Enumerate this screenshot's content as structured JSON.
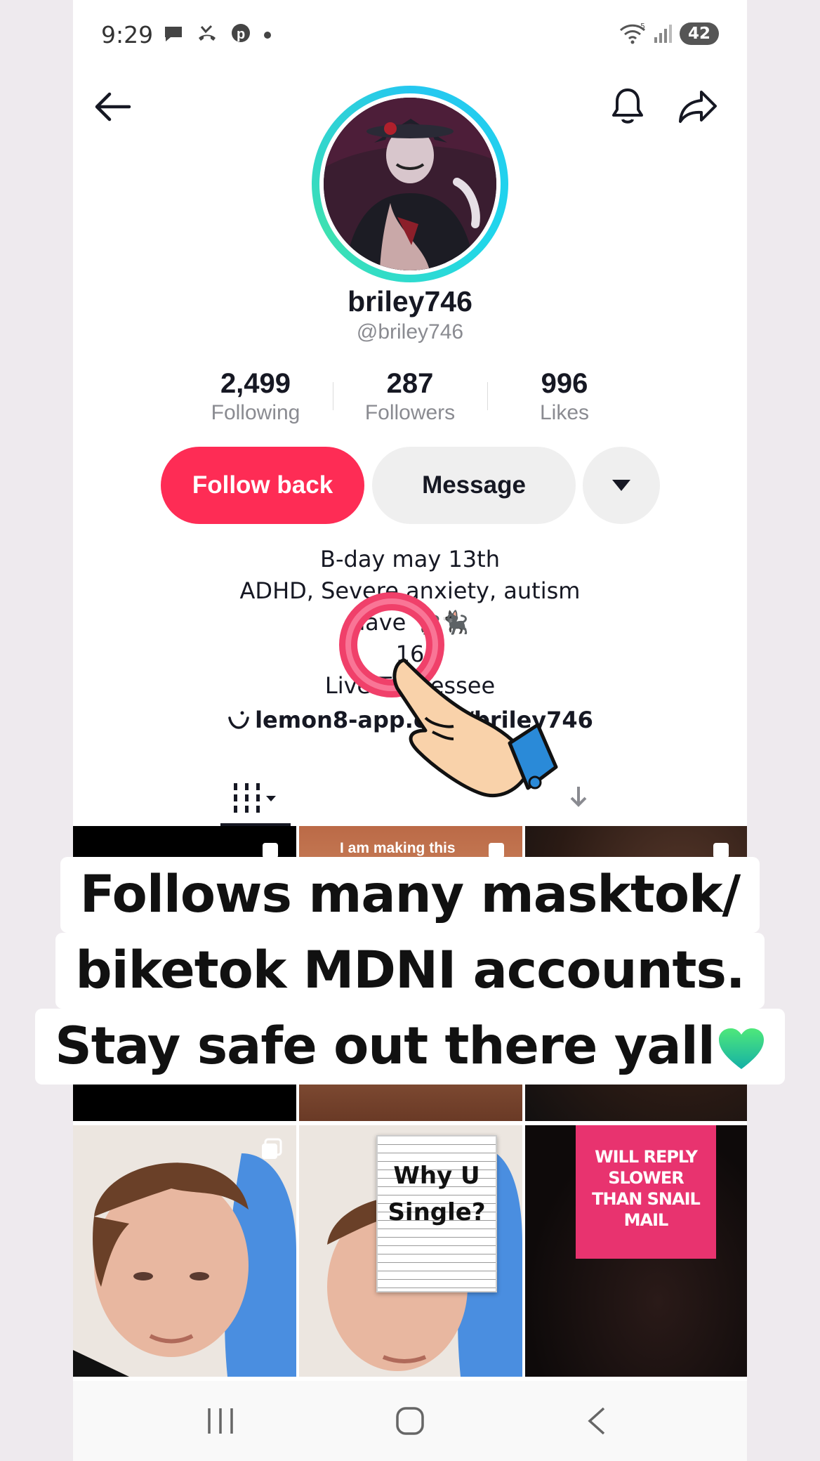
{
  "status_bar": {
    "time": "9:29",
    "left_icons": [
      "chat-bubble-icon",
      "missed-call-icon",
      "pinterest-icon",
      "dot-icon"
    ],
    "signal_label": "5",
    "battery": "42"
  },
  "profile": {
    "display_name": "briley746",
    "handle": "@briley746",
    "stats": [
      {
        "value": "2,499",
        "label": "Following"
      },
      {
        "value": "287",
        "label": "Followers"
      },
      {
        "value": "996",
        "label": "Likes"
      }
    ],
    "follow_button": "Follow back",
    "message_button": "Message",
    "bio_lines": [
      "B-day may 13th",
      "ADHD, Severe anxiety, autism",
      "have 🐈‍⬛🐈‍⬛",
      "16",
      "Live Tennessee"
    ],
    "link": "lemon8-app.com/briley746"
  },
  "grid": {
    "tile_text": "I am making this",
    "why_single": [
      "Why U",
      "Single?"
    ],
    "reply_note": [
      "WILL REPLY",
      "SLOWER",
      "THAN SNAIL",
      "MAIL"
    ]
  },
  "caption": {
    "lines": [
      "Follows many masktok/",
      "biketok MDNI accounts.",
      "Stay safe out there yall"
    ],
    "emoji": "green-heart-icon"
  },
  "colors": {
    "follow_accent": "#fe2c55",
    "avatar_ring": "#25c7f0",
    "pink_note": "#e8336f"
  }
}
